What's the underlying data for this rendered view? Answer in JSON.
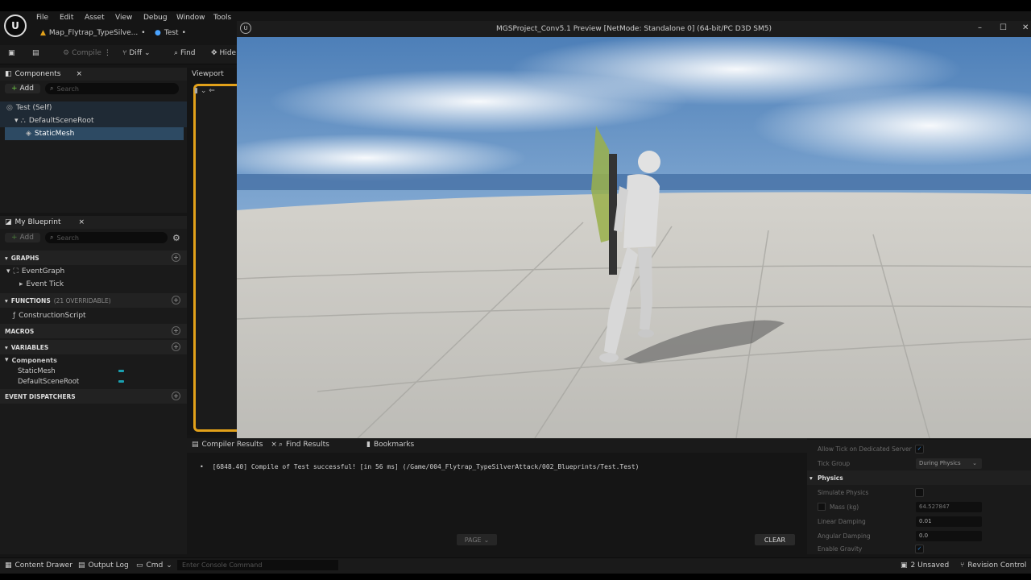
{
  "menu": [
    "File",
    "Edit",
    "Asset",
    "View",
    "Debug",
    "Window",
    "Tools",
    "Help"
  ],
  "tabs": [
    {
      "label": "Map_Flytrap_TypeSilve...",
      "modified": "•"
    },
    {
      "label": "Test",
      "modified": "•"
    }
  ],
  "toolbar": {
    "compile": "Compile",
    "diff": "Diff",
    "find": "Find",
    "hide": "Hide"
  },
  "components": {
    "title": "Components",
    "add": "Add",
    "search_placeholder": "Search",
    "tree": [
      "Test (Self)",
      "DefaultSceneRoot",
      "StaticMesh"
    ]
  },
  "viewport_tab": "Viewport",
  "my_blueprint": {
    "title": "My Blueprint",
    "add": "Add",
    "search_placeholder": "Search",
    "graphs": "GRAPHS",
    "event_graph": "EventGraph",
    "event_tick": "Event Tick",
    "functions": "FUNCTIONS",
    "functions_overridable": "(21 OVERRIDABLE)",
    "construction_script": "ConstructionScript",
    "macros": "MACROS",
    "variables": "VARIABLES",
    "components_group": "Components",
    "var_static_mesh": "StaticMesh",
    "var_default_scene_root": "DefaultSceneRoot",
    "event_dispatchers": "EVENT DISPATCHERS"
  },
  "preview": {
    "title": "MGSProject_Conv5.1 Preview [NetMode: Standalone 0]  (64-bit/PC D3D SM5)"
  },
  "output": {
    "tabs": [
      "Compiler Results",
      "Find Results",
      "Bookmarks"
    ],
    "log": "[6848.40] Compile of Test successful! [in 56 ms] (/Game/004_Flytrap_TypeSilverAttack/002_Blueprints/Test.Test)",
    "page": "PAGE",
    "clear": "CLEAR"
  },
  "details": {
    "allow_tick": "Allow Tick on Dedicated Server",
    "tick_group": "Tick Group",
    "tick_group_value": "During Physics",
    "physics": "Physics",
    "simulate_physics": "Simulate Physics",
    "mass": "Mass (kg)",
    "mass_value": "64.527847",
    "linear_damping": "Linear Damping",
    "linear_damping_value": "0.01",
    "angular_damping": "Angular Damping",
    "angular_damping_value": "0.0",
    "enable_gravity": "Enable Gravity"
  },
  "status": {
    "content_drawer": "Content Drawer",
    "output_log": "Output Log",
    "cmd": "Cmd",
    "console_placeholder": "Enter Console Command",
    "unsaved": "2 Unsaved",
    "revision_control": "Revision Control"
  },
  "colors": {
    "accent_orange": "#e2a11a",
    "selection_blue": "#2d4a63",
    "variable_cyan": "#1aa0b0"
  }
}
